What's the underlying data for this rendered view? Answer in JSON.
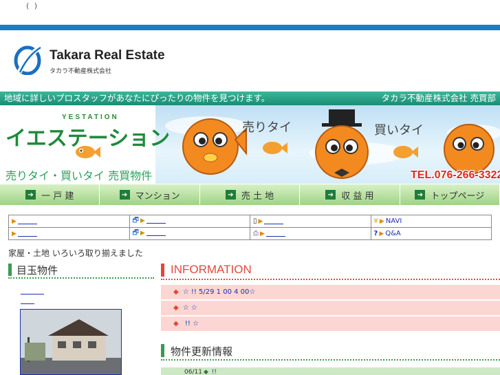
{
  "top_parens": "(    )",
  "logo": {
    "name": "Takara Real Estate",
    "subtitle": "タカラ不動産株式会社"
  },
  "tagline": {
    "left": "地域に詳しいプロスタッフがあなたにぴったりの物件を見つけます。",
    "right": "タカラ不動産株式会社 売買部"
  },
  "banner": {
    "yestation": "YESTATION",
    "brand": "イエステーション",
    "description": "売りタイ・買いタイ 売買物件",
    "sell": "売りタイ",
    "buy": "買いタイ",
    "tel": "TEL.076-266-3322"
  },
  "nav": [
    {
      "label": "一 戸 建"
    },
    {
      "label": "マンション"
    },
    {
      "label": "売 土 地"
    },
    {
      "label": "収 益 用"
    },
    {
      "label": "トップページ"
    }
  ],
  "links": {
    "navi": "NAVI",
    "qa": "Q&A"
  },
  "catch_text": "家屋・土地 いろいろ取り揃えました",
  "featured": {
    "title": "目玉物件"
  },
  "information": {
    "title": "INFORMATION",
    "items": [
      {
        "text": "☆              !! 5/29    1 00   4 00☆"
      },
      {
        "text": "☆                       ☆"
      },
      {
        "text": "            !!         ☆"
      }
    ]
  },
  "updates": {
    "title": "物件更新情報",
    "rows": [
      {
        "date": "06/11",
        "text": "                  !!"
      }
    ]
  },
  "colors": {
    "blue_bar": "#1a7cc3",
    "tagline_green": "#1a8d74",
    "nav_green": "#9fd385",
    "info_red": "#e4473b",
    "news_pink": "#fcd6d2",
    "update_green": "#cde8c4"
  }
}
